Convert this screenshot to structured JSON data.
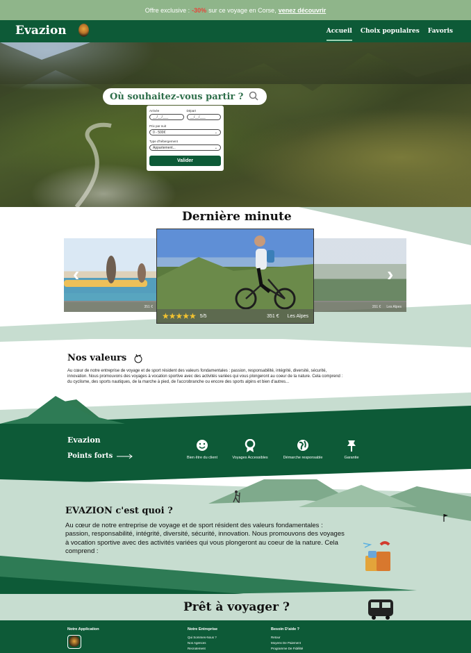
{
  "promo": {
    "text": "Offre exclusive :",
    "discount": "-30%",
    "middle": "sur ce voyage en Corse,",
    "link": "venez découvrir"
  },
  "nav": {
    "brand": "Evazion",
    "items": [
      "Accueil",
      "Choix populaires",
      "Favoris"
    ],
    "active": "Accueil"
  },
  "hero": {
    "search_placeholder": "Où souhaitez-vous partir ?",
    "form": {
      "arrival_label": "Arrivée",
      "arrival_value": "__/__/___",
      "departure_label": "Départ",
      "departure_value": "__/__/___",
      "price_label": "Prix par nuit",
      "price_value": "0 - 500€",
      "lodging_label": "Type d'hébergement",
      "lodging_value": "Appartement...",
      "submit": "Valider"
    }
  },
  "last_minute": {
    "title": "Dernière minute",
    "main_card": {
      "stars": "★★★★★",
      "rating": "5/5",
      "price": "351 €",
      "place": "Les Alpes"
    },
    "left_card": {
      "price": "351 €"
    },
    "right_card": {
      "price": "351 €",
      "place": "Les Alpes"
    }
  },
  "values": {
    "title": "Nos valeurs",
    "text": "Au cœur de notre entreprise de voyage et de sport résident des valeurs fondamentales : passion, responsabilité, intégrité, diversité, sécurité, innovation. Nous promouvons des voyages à vocation sportive avec des activités variées qui vous plongeront au coeur de la nature. Cela comprend : du cyclisme, des sports nautiques, de la marche à pied, de l'accrobranche ou encore des sports alpins et bien d'autres..."
  },
  "highlights": {
    "brand": "Evazion",
    "title": "Points forts",
    "items": [
      "Bien être du client",
      "Voyages Accessibles",
      "Démarche responsable",
      "Garantie"
    ]
  },
  "about": {
    "title": "EVAZION c'est quoi ?",
    "text": "Au cœur de notre entreprise de voyage et de sport résident des valeurs fondamentales : passion, responsabilité, intégrité, diversité, sécurité, innovation. Nous promouvons des voyages à vocation sportive avec des activités variées qui vous plongeront au coeur de la nature. Cela comprend :"
  },
  "ready": {
    "title": "Prêt à voyager ?"
  },
  "footer": {
    "app_title": "Notre Application",
    "company_title": "Notre Entreprise",
    "company_links": [
      "Qui Sommes-Nous ?",
      "Nos Agences",
      "Recrutement"
    ],
    "help_title": "Besoin D'aide ?",
    "help_links": [
      "Retour",
      "Moyens De Paiement",
      "Programme De Fidélité"
    ]
  },
  "colors": {
    "brand_green": "#0d5a37",
    "promo_green": "#8fb58a",
    "discount_red": "#e5463a",
    "pale_green": "#c7ddd0"
  }
}
